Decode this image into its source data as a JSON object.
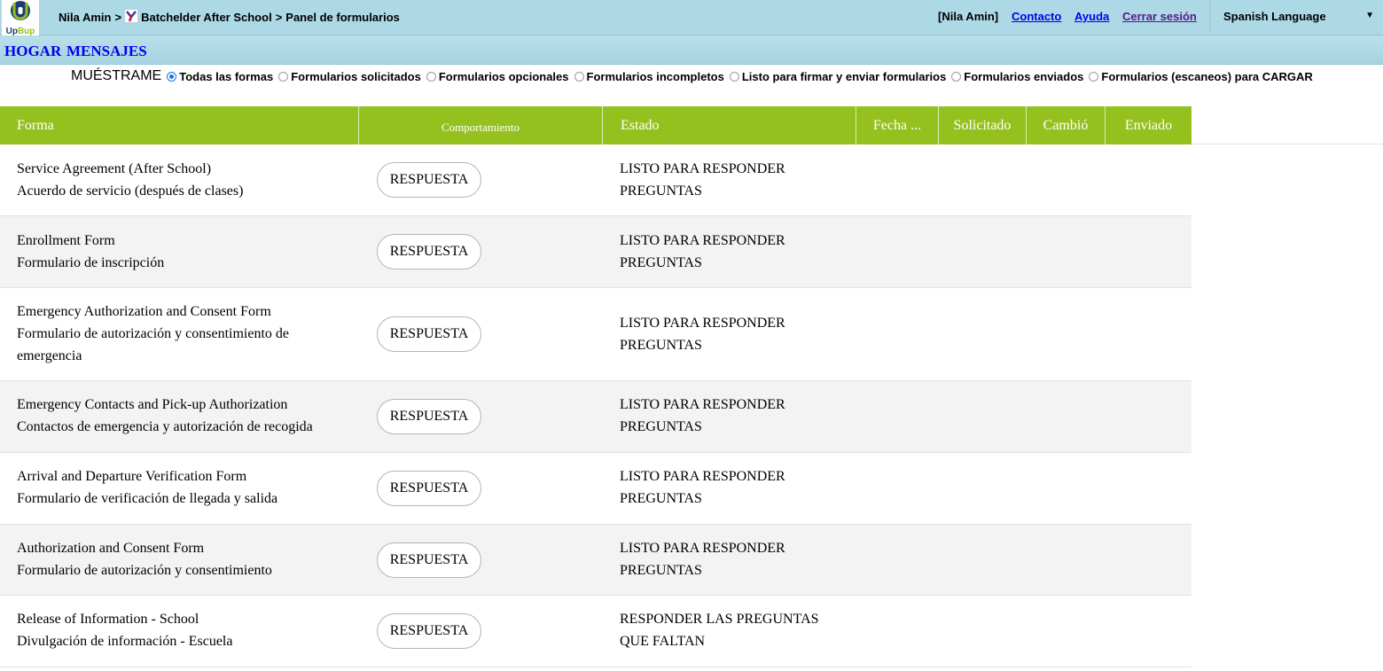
{
  "header": {
    "logo_text": "UpBup",
    "breadcrumb": [
      "Nila Amin",
      "Batchelder After School",
      "Panel de formularios"
    ],
    "separator": ">",
    "user_label": "[Nila Amin]",
    "links": {
      "contact": "Contacto",
      "help": "Ayuda",
      "logout": "Cerrar sesión"
    },
    "language": "Spanish Language"
  },
  "nav": {
    "home": "HOGAR",
    "messages": "MENSAJES"
  },
  "filters": {
    "label": "MUÉSTRAME",
    "options": [
      "Todas las formas",
      "Formularios solicitados",
      "Formularios opcionales",
      "Formularios incompletos",
      "Listo para firmar y enviar formularios",
      "Formularios enviados",
      "Formularios (escaneos) para CARGAR"
    ],
    "selected": 0
  },
  "table": {
    "columns": [
      "Forma",
      "Comportamiento",
      "Estado",
      "Fecha ...",
      "Solicitado",
      "Cambió",
      "Enviado"
    ],
    "rows": [
      {
        "form": [
          "Service Agreement (After School)",
          "Acuerdo de servicio (después de clases)"
        ],
        "action": "RESPUESTA",
        "status": [
          "LISTO PARA RESPONDER",
          "PREGUNTAS"
        ]
      },
      {
        "form": [
          "Enrollment Form",
          "Formulario de inscripción"
        ],
        "action": "RESPUESTA",
        "status": [
          "LISTO PARA RESPONDER",
          "PREGUNTAS"
        ]
      },
      {
        "form": [
          "Emergency Authorization and Consent Form",
          "Formulario de autorización y consentimiento de",
          "emergencia"
        ],
        "action": "RESPUESTA",
        "status": [
          "LISTO PARA RESPONDER",
          "PREGUNTAS"
        ]
      },
      {
        "form": [
          "Emergency Contacts and Pick-up Authorization",
          "Contactos de emergencia y autorización de recogida"
        ],
        "action": "RESPUESTA",
        "status": [
          "LISTO PARA RESPONDER",
          "PREGUNTAS"
        ]
      },
      {
        "form": [
          "Arrival and Departure Verification Form",
          "Formulario de verificación de llegada y salida"
        ],
        "action": "RESPUESTA",
        "status": [
          "LISTO PARA RESPONDER",
          "PREGUNTAS"
        ]
      },
      {
        "form": [
          "Authorization and Consent Form",
          "Formulario de autorización y consentimiento"
        ],
        "action": "RESPUESTA",
        "status": [
          "LISTO PARA RESPONDER",
          "PREGUNTAS"
        ]
      },
      {
        "form": [
          "Release of Information - School",
          "Divulgación de información - Escuela"
        ],
        "action": "RESPUESTA",
        "status": [
          "RESPONDER LAS PREGUNTAS",
          "QUE FALTAN"
        ]
      }
    ]
  },
  "colors": {
    "header_bg": "#add8e6",
    "table_header_bg": "#95c11f",
    "link": "#0000ee",
    "radio_selected": "#1a73e8"
  }
}
